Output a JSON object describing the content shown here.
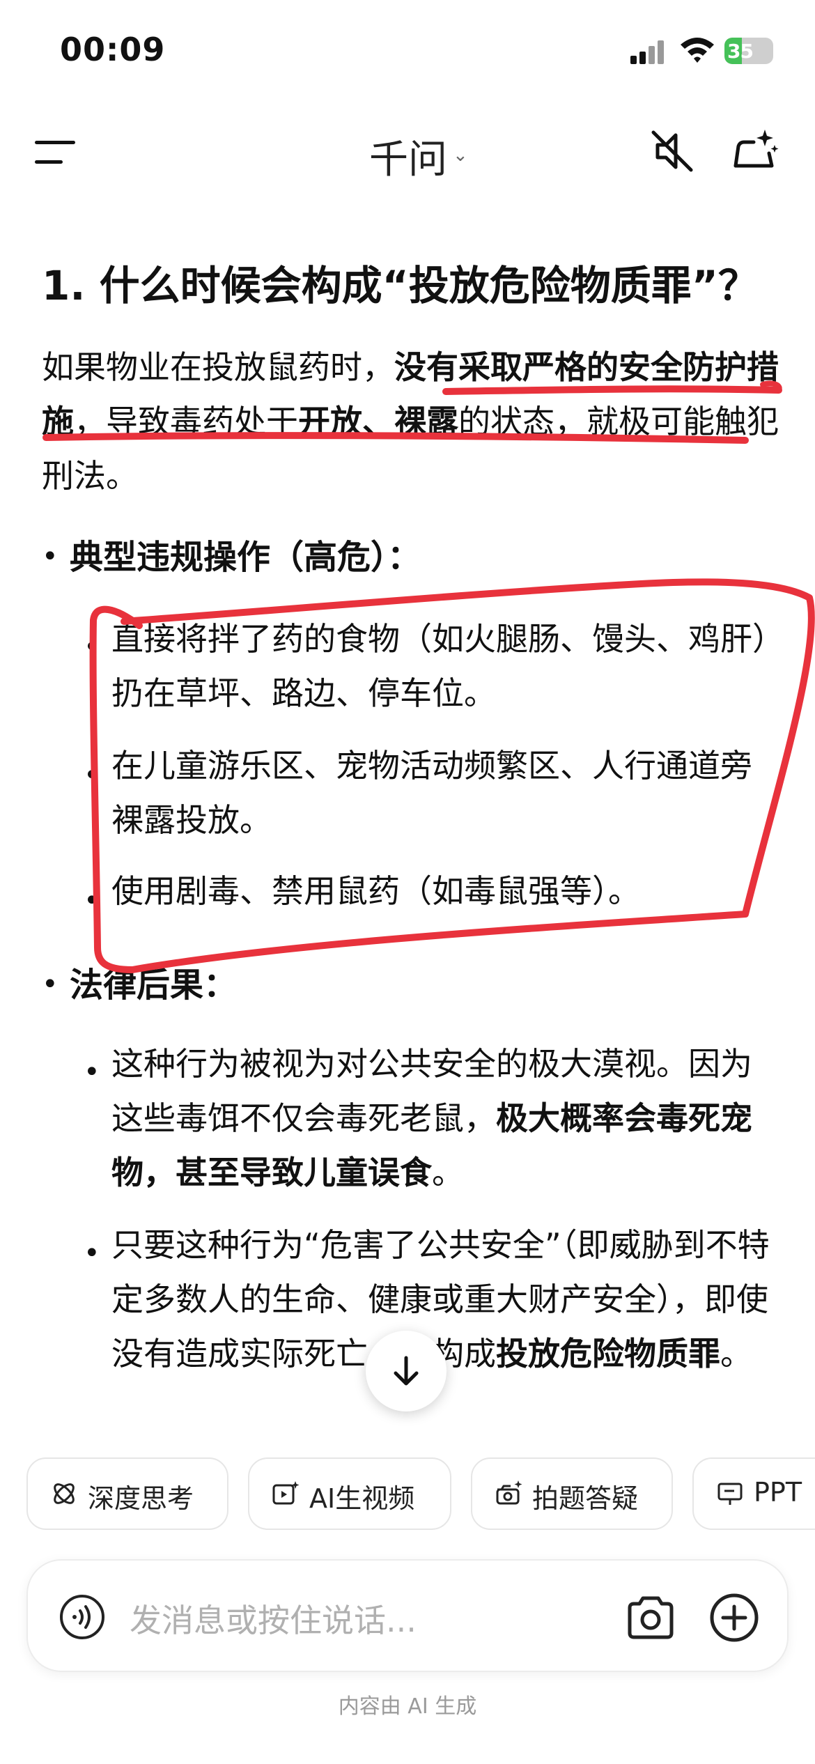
{
  "status_bar": {
    "time": "00:09",
    "battery": "35",
    "battery_level": 0.35
  },
  "nav": {
    "title": "千问",
    "chevron": "⌄"
  },
  "content": {
    "heading": "1. 什么时候会构成“投放危险物质罪”？",
    "intro": {
      "p1": "如果物业在投放鼠药时，",
      "b1": "没有采取严格的安全防护措施",
      "p2": "，导致毒药处于",
      "b2": "开放、裸露",
      "p3": "的状态，就极可能触犯刑法。"
    },
    "section1": {
      "title": "典型违规操作（高危）：",
      "items": [
        "直接将拌了药的食物（如火腿肠、馒头、鸡肝）扔在草坪、路边、停车位。",
        "在儿童游乐区、宠物活动频繁区、人行通道旁裸露投放。",
        "使用剧毒、禁用鼠药（如毒鼠强等）。"
      ]
    },
    "section2": {
      "title": "法律后果：",
      "item1": {
        "p1": "这种行为被视为对公共安全的极大漠视。因为这些毒饵不仅会毒死老鼠，",
        "b1": "极大概率会毒死宠物，甚至导致儿童误食",
        "p2": "。"
      },
      "item2": {
        "p1": "只要这种行为“危害了公共安全”（即威胁到不特定多数人的生命、健康或重大财产安全），即使没有造成实际死亡，也构成",
        "b1": "投放危险物质罪",
        "p2": "。"
      }
    }
  },
  "chips": [
    {
      "label": "深度思考",
      "icon": "atom-icon"
    },
    {
      "label": "AI生视频",
      "icon": "video-sparkle-icon"
    },
    {
      "label": "拍题答疑",
      "icon": "camera-sparkle-icon"
    },
    {
      "label": "PPT",
      "icon": "presentation-icon"
    }
  ],
  "input": {
    "placeholder": "发消息或按住说话..."
  },
  "footer": "内容由 AI 生成",
  "colors": {
    "annotation": "#e8323c",
    "battery_green": "#45c158"
  }
}
